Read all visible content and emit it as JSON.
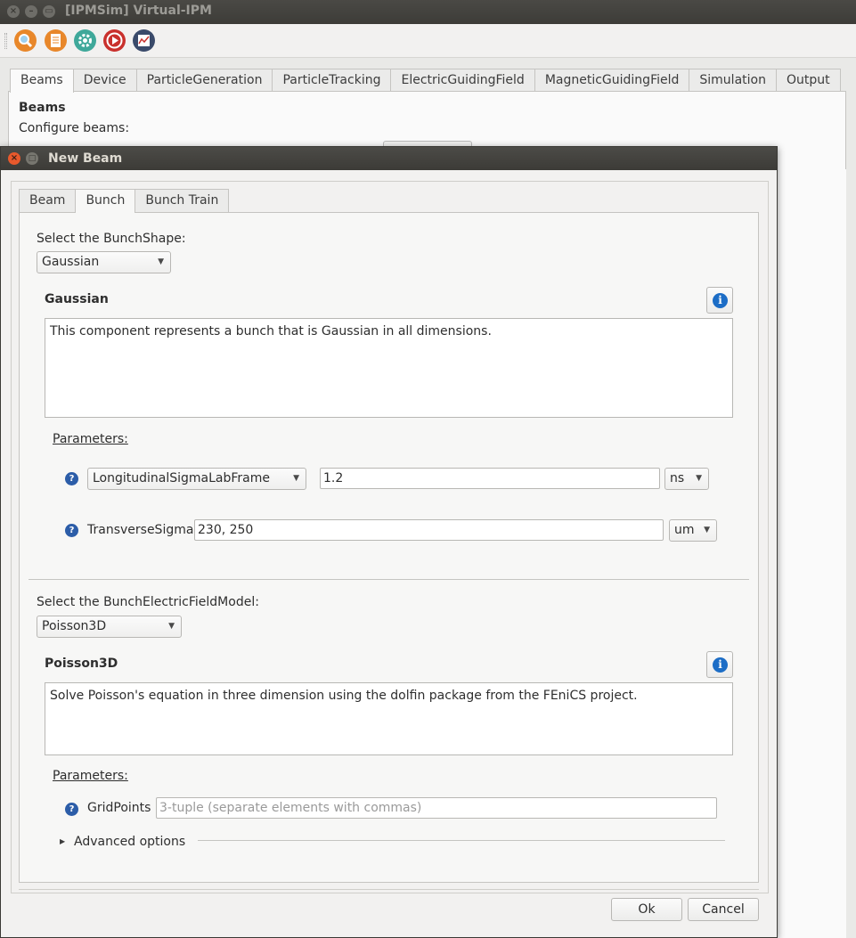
{
  "window": {
    "title": "[IPMSim] Virtual-IPM",
    "close_glyph": "×",
    "min_glyph": "–",
    "max_glyph": "▭"
  },
  "toolbar": {
    "icons": [
      "search-icon",
      "document-icon",
      "gear-icon",
      "play-icon",
      "chart-icon"
    ]
  },
  "main_tabs": [
    "Beams",
    "Device",
    "ParticleGeneration",
    "ParticleTracking",
    "ElectricGuidingField",
    "MagneticGuidingField",
    "Simulation",
    "Output"
  ],
  "main": {
    "heading": "Beams",
    "subheading": "Configure beams:"
  },
  "dialog": {
    "title": "New Beam",
    "close_glyph": "×",
    "max_glyph": "□",
    "tabs": [
      "Beam",
      "Bunch",
      "Bunch Train"
    ],
    "active_tab": "Bunch",
    "shape": {
      "label": "Select the BunchShape:",
      "selected": "Gaussian",
      "title": "Gaussian",
      "description": "This component represents a bunch that is Gaussian in all dimensions.",
      "params_label": "Parameters:",
      "params": [
        {
          "name": "LongitudinalSigmaLabFrame",
          "value": "1.2",
          "unit": "ns"
        },
        {
          "name": "TransverseSigma",
          "value": "230, 250",
          "unit": "um"
        }
      ]
    },
    "field": {
      "label": "Select the BunchElectricFieldModel:",
      "selected": "Poisson3D",
      "title": "Poisson3D",
      "description": "Solve Poisson's equation in three dimension using the dolfin package from the FEniCS project.",
      "params_label": "Parameters:",
      "grid_label": "GridPoints",
      "grid_placeholder": "3-tuple (separate elements with commas)",
      "advanced": "Advanced options"
    },
    "ok": "Ok",
    "cancel": "Cancel",
    "info_glyph": "i",
    "help_glyph": "?",
    "dropdown_glyph": "▼",
    "expand_glyph": "▶"
  },
  "colors": {
    "accent_info": "#1c6dc6",
    "titlebar": "#3c3b37",
    "close_button": "#e8592c"
  }
}
